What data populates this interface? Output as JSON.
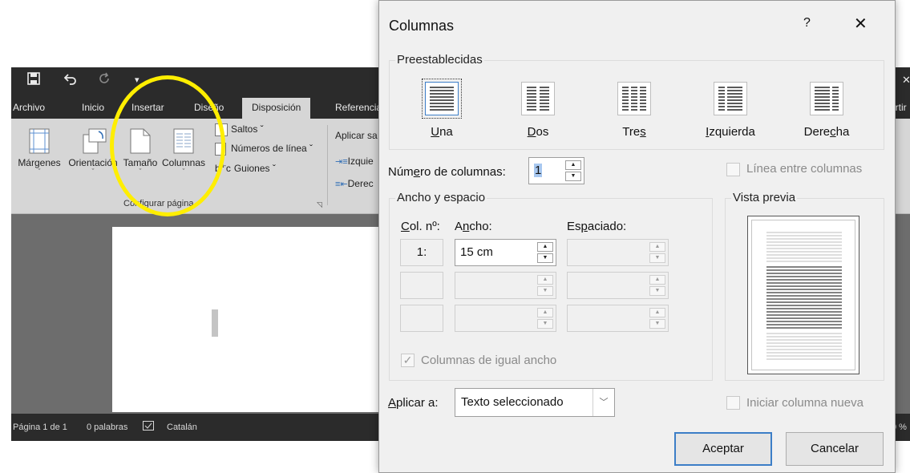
{
  "word": {
    "quick_access": {
      "save_icon": "save-icon",
      "undo_icon": "undo-icon",
      "redo_icon": "redo-icon",
      "customize": "▾"
    },
    "tabs": [
      "Archivo",
      "Inicio",
      "Insertar",
      "Diseño",
      "Disposición",
      "Referencia"
    ],
    "active_tab": "Disposición",
    "right_tab_fragment": "artir",
    "ribbon": {
      "margins": "Márgenes",
      "orientation": "Orientación",
      "size": "Tamaño",
      "columns": "Columnas",
      "breaks": "Saltos ˇ",
      "line_numbers": "Números de línea ˇ",
      "hyphenation": "Guiones ˇ",
      "apply_to": "Aplicar sa",
      "indent_left": "Izquie",
      "indent_right": "Derec",
      "dropdown_arrow": "ˇ",
      "group_label": "Configurar página"
    },
    "status": {
      "page": "Página 1 de 1",
      "words": "0 palabras",
      "language": "Catalán",
      "zoom_fragment": "0 %"
    }
  },
  "dialog": {
    "title": "Columnas",
    "help": "?",
    "close": "✕",
    "presets_label": "Preestablecidas",
    "presets": [
      {
        "label": "Una",
        "key": "U",
        "rest": "na",
        "mode": "pre"
      },
      {
        "label": "Dos",
        "key": "D",
        "rest": "os",
        "mode": "pre"
      },
      {
        "label": "Tres",
        "pre": "Tre",
        "key": "s",
        "mode": "post"
      },
      {
        "label": "Izquierda",
        "key": "I",
        "rest": "zquierda",
        "mode": "pre"
      },
      {
        "label": "Derecha",
        "pre": "Dere",
        "key": "c",
        "post": "ha",
        "mode": "mid"
      }
    ],
    "num_columns": {
      "pre": "Núm",
      "key": "e",
      "post": "ro de columnas:",
      "value": "1"
    },
    "line_between": "Línea entre columnas",
    "width_spacing_label": "Ancho y espacio",
    "col_header": {
      "pre": "",
      "key": "C",
      "post": "ol. nº:"
    },
    "width_header": {
      "pre": "A",
      "key": "n",
      "post": "cho:"
    },
    "spacing_header": {
      "pre": "Es",
      "key": "p",
      "post": "aciado:"
    },
    "rows": [
      {
        "col": "1:",
        "width": "15 cm",
        "spacing": ""
      },
      {
        "col": "",
        "width": "",
        "spacing": ""
      },
      {
        "col": "",
        "width": "",
        "spacing": ""
      }
    ],
    "equal_width": "Columnas de igual ancho",
    "preview_label": "Vista previa",
    "apply_to": {
      "key": "A",
      "post": "plicar a:",
      "value": "Texto seleccionado"
    },
    "start_new_column": "Iniciar columna nueva",
    "ok": "Aceptar",
    "cancel": "Cancelar",
    "spin_up": "▲",
    "spin_down": "▼",
    "combo_arrow": "﹀",
    "check_mark": "✓"
  },
  "colors": {
    "highlight": "#ffee00",
    "accent": "#3c7ec7",
    "ribbon": "#d6d6d6",
    "titlebar": "#2b2b2b"
  }
}
